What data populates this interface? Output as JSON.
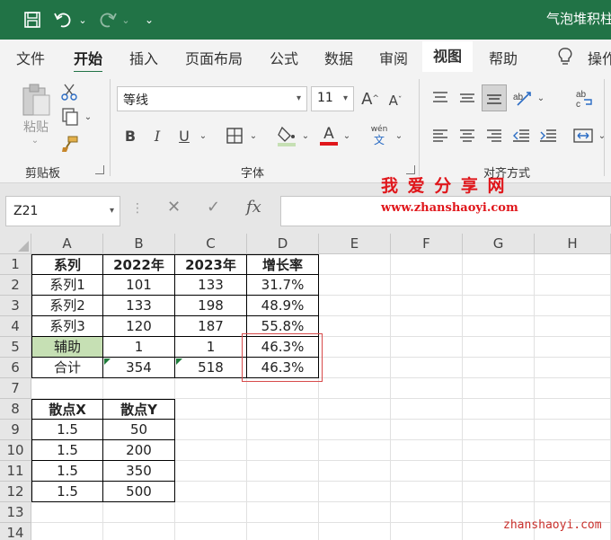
{
  "window": {
    "title": "气泡堆积柱"
  },
  "tabs": [
    "文件",
    "开始",
    "插入",
    "页面布局",
    "公式",
    "数据",
    "审阅",
    "视图",
    "帮助",
    "操作"
  ],
  "ribbon": {
    "clipboard": {
      "paste_label": "粘贴",
      "group_label": "剪贴板"
    },
    "font": {
      "font_name": "等线",
      "font_size": "11",
      "bold": "B",
      "italic": "I",
      "underline": "U",
      "font_color_glyph": "A",
      "phonetic_top": "wén",
      "phonetic_bottom": "文",
      "grow": "A",
      "shrink": "A",
      "group_label": "字体"
    },
    "alignment": {
      "group_label": "对齐方式"
    }
  },
  "formula_bar": {
    "name_box": "Z21",
    "fx_label": "fx",
    "cancel_glyph": "✕",
    "enter_glyph": "✓"
  },
  "watermark": {
    "line1": "我 爱 分 享 网",
    "line2": "www.zhanshaoyi.com",
    "corner": "zhanshaoyi.com"
  },
  "sheet": {
    "columns": [
      "A",
      "B",
      "C",
      "D",
      "E",
      "F",
      "G",
      "H"
    ],
    "rows": [
      "1",
      "2",
      "3",
      "4",
      "5",
      "6",
      "7",
      "8",
      "9",
      "10",
      "11",
      "12",
      "13",
      "14"
    ],
    "table1": [
      [
        "系列",
        "2022年",
        "2023年",
        "增长率"
      ],
      [
        "系列1",
        "101",
        "133",
        "31.7%"
      ],
      [
        "系列2",
        "133",
        "198",
        "48.9%"
      ],
      [
        "系列3",
        "120",
        "187",
        "55.8%"
      ],
      [
        "辅助",
        "1",
        "1",
        "46.3%"
      ],
      [
        "合计",
        "354",
        "518",
        "46.3%"
      ]
    ],
    "table2": [
      [
        "散点X",
        "散点Y"
      ],
      [
        "1.5",
        "50"
      ],
      [
        "1.5",
        "200"
      ],
      [
        "1.5",
        "350"
      ],
      [
        "1.5",
        "500"
      ]
    ]
  },
  "colors": {
    "excel_green": "#217346",
    "helper_fill": "#c6e0b4",
    "highlight_red": "#d84a4a"
  }
}
